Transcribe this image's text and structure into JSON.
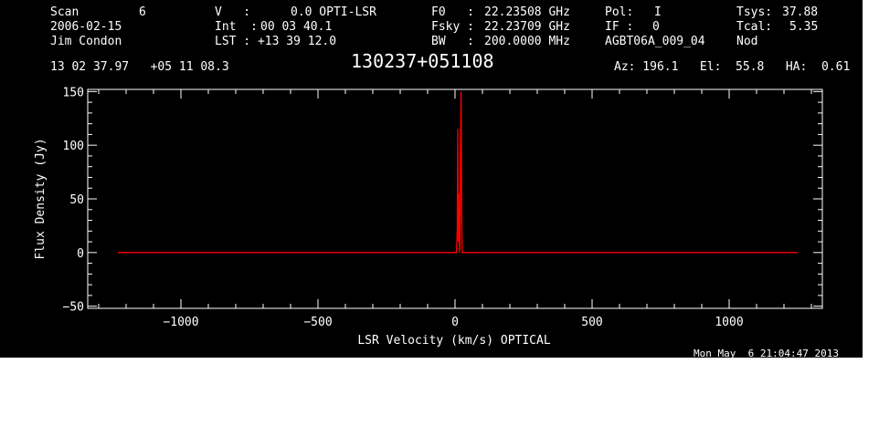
{
  "header": {
    "scan_label": "Scan",
    "scan_number": "6",
    "date": "2006-02-15",
    "observer": "Jim Condon",
    "v_label": "V   :",
    "v_value": "0.0 OPTI-LSR",
    "int_label": "Int  :",
    "int_value": "00 03 40.1",
    "lst_label": "LST : +13 39 12.0",
    "f0_label": "F0   :",
    "f0_value": "22.23508 GHz",
    "fsky_label": "Fsky :",
    "fsky_value": "22.23709 GHz",
    "bw_label": "BW   :",
    "bw_value": "200.0000 MHz",
    "pol_label": "Pol:",
    "pol_value": "I",
    "if_label": "IF :",
    "if_value": "0",
    "project": "AGBT06A_009_04",
    "tsys_label": "Tsys:",
    "tsys_value": "37.88",
    "tcal_label": "Tcal:",
    "tcal_value": "5.35",
    "mode": "Nod",
    "coords": "13 02 37.97   +05 11 08.3",
    "source": "130237+051108",
    "az_el_ha": "Az: 196.1   El:  55.8   HA:  0.61",
    "timestamp": "Mon May  6 21:04:47 2013"
  },
  "colors": {
    "background": "#000000",
    "axes": "#ffffff",
    "trace": "#ff0000"
  },
  "chart_data": {
    "type": "line",
    "xlabel": "LSR Velocity (km/s) OPTICAL",
    "ylabel": "Flux Density (Jy)",
    "xlim": [
      -1340,
      1340
    ],
    "ylim": [
      -52,
      152
    ],
    "x_ticks": [
      -1000,
      -500,
      0,
      500,
      1000
    ],
    "x_tick_labels": [
      "−1000",
      "−500",
      "0",
      "500",
      "1000"
    ],
    "y_ticks": [
      -50,
      0,
      50,
      100,
      150
    ],
    "y_tick_labels": [
      "−50",
      "0",
      "50",
      "100",
      "150"
    ],
    "grid": false,
    "series": [
      {
        "x": [
          -1230,
          0,
          5,
          8,
          10,
          12,
          14,
          16,
          18,
          20,
          22,
          24,
          26,
          28,
          32,
          1250
        ],
        "y": [
          0,
          0,
          0,
          20,
          115,
          10,
          55,
          0,
          5,
          100,
          150,
          40,
          0,
          0,
          0,
          0
        ]
      }
    ]
  }
}
